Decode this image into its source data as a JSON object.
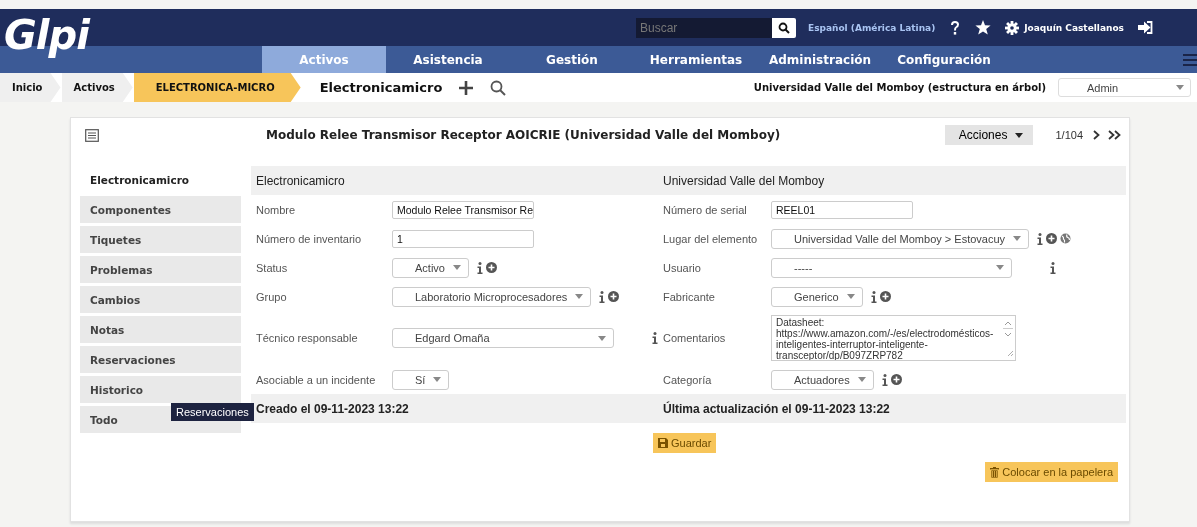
{
  "header": {
    "logo": "Glpi",
    "search": {
      "placeholder": "Buscar"
    },
    "language": "Español (América Latina)",
    "user": "Joaquín Castellanos"
  },
  "menu": [
    {
      "label": "Activos",
      "selected": true
    },
    {
      "label": "Asistencia",
      "selected": false
    },
    {
      "label": "Gestión",
      "selected": false
    },
    {
      "label": "Herramientas",
      "selected": false
    },
    {
      "label": "Administración",
      "selected": false
    },
    {
      "label": "Configuración",
      "selected": false
    }
  ],
  "breadcrumb": [
    {
      "label": "Inicio",
      "selected": false
    },
    {
      "label": "Activos",
      "selected": false
    },
    {
      "label": "ELECTRONICA-MICRO",
      "selected": true
    }
  ],
  "page_title": "Electronicamicro",
  "entity": "Universidad Valle del Momboy (estructura en árbol)",
  "profile": "Admin",
  "card": {
    "title": "Modulo Relee Transmisor Receptor AOICRIE (Universidad Valle del Momboy)",
    "actions": "Acciones",
    "pager": "1/104"
  },
  "tabs": [
    {
      "label": "Electronicamicro",
      "selected": true
    },
    {
      "label": "Componentes",
      "selected": false
    },
    {
      "label": "Tiquetes",
      "selected": false
    },
    {
      "label": "Problemas",
      "selected": false
    },
    {
      "label": "Cambios",
      "selected": false
    },
    {
      "label": "Notas",
      "selected": false
    },
    {
      "label": "Reservaciones",
      "selected": false
    },
    {
      "label": "Historico",
      "selected": false
    },
    {
      "label": "Todo",
      "selected": false
    }
  ],
  "tooltip": "Reservaciones",
  "form": {
    "headers": [
      "Electronicamicro",
      "Universidad Valle del Momboy"
    ],
    "rows": [
      {
        "left": {
          "label": "Nombre",
          "kind": "text",
          "value": "Modulo Relee Transmisor Re",
          "info": false,
          "add": false
        },
        "right": {
          "label": "Número de serial",
          "kind": "text",
          "value": "REEL01",
          "info": false,
          "add": false
        }
      },
      {
        "left": {
          "label": "Número de inventario",
          "kind": "text",
          "value": "1",
          "info": false,
          "add": false
        },
        "right": {
          "label": "Lugar del elemento",
          "kind": "wide-select",
          "value": "Universidad Valle del Momboy > Estovacuy",
          "info": true,
          "add": true,
          "globe": true
        }
      },
      {
        "left": {
          "label": "Status",
          "kind": "select",
          "value": "Activo",
          "info": true,
          "add": true
        },
        "right": {
          "label": "Usuario",
          "kind": "person-select",
          "value": "-----",
          "info": true,
          "add": false
        }
      },
      {
        "left": {
          "label": "Grupo",
          "kind": "select",
          "value": "Laboratorio Microprocesadores",
          "info": true,
          "add": true
        },
        "right": {
          "label": "Fabricante",
          "kind": "select",
          "value": "Generico",
          "info": true,
          "add": true
        }
      },
      {
        "left": {
          "label": "Técnico responsable",
          "kind": "person-select",
          "value": "Edgard Omaña",
          "info": true,
          "add": false
        },
        "right": {
          "label": "Comentarios",
          "kind": "textarea",
          "value": "Datasheet:\nhttps://www.amazon.com/-/es/electrodomésticos-inteligentes-interruptor-inteligente-transceptor/dp/B097ZRP782",
          "info": false,
          "add": false
        }
      },
      {
        "left": {
          "label": "Asociable a un incidente",
          "kind": "select",
          "value": "Sí",
          "info": false,
          "add": false
        },
        "right": {
          "label": "Categoría",
          "kind": "select",
          "value": "Actuadores",
          "info": true,
          "add": true
        }
      }
    ],
    "footer": [
      "Creado el 09-11-2023 13:22",
      "Última actualización el 09-11-2023 13:22"
    ]
  },
  "buttons": {
    "save": "Guardar",
    "trash": "Colocar en la papelera"
  }
}
